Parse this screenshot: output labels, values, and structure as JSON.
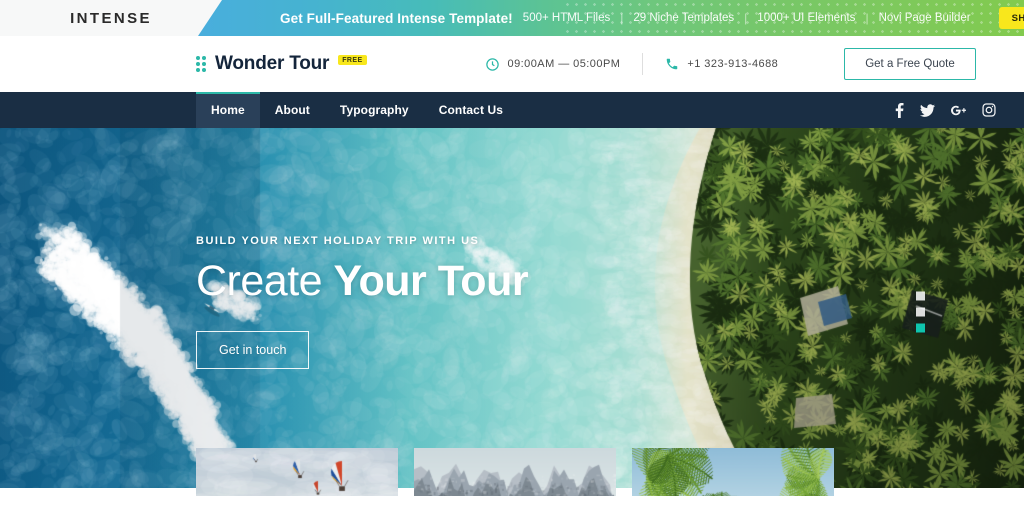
{
  "promo": {
    "logo_text": "INTENSE",
    "headline": "Get Full-Featured Intense Template!",
    "features": [
      "500+ HTML Files",
      "29 Niche Templates",
      "1000+ UI Elements",
      "Novi Page Builder"
    ],
    "separator": "|",
    "cta_label": "SHOP NOW!",
    "gradient_start": "#49aedd",
    "gradient_end": "#82ca4e",
    "cta_color": "#f8e71c"
  },
  "header": {
    "brand_name": "Wonder Tour",
    "brand_badge": "FREE",
    "hours": "09:00AM — 05:00PM",
    "phone": "+1 323-913-4688",
    "quote_label": "Get a Free Quote",
    "accent_color": "#2cb8a8"
  },
  "nav": {
    "items": [
      {
        "label": "Home",
        "active": true
      },
      {
        "label": "About",
        "active": false
      },
      {
        "label": "Typography",
        "active": false
      },
      {
        "label": "Contact Us",
        "active": false
      }
    ],
    "social": [
      "facebook-icon",
      "twitter-icon",
      "google-plus-icon",
      "instagram-icon"
    ],
    "bar_color": "#1a2e44",
    "active_indicator_color": "#2cb8a8"
  },
  "hero": {
    "kicker": "BUILD YOUR NEXT HOLIDAY TRIP WITH US",
    "title_light": "Create",
    "title_bold": "Your Tour",
    "button_label": "Get in touch",
    "slides_total": 3,
    "slide_active": 3,
    "scene": "aerial-tropical-beach-with-palm-forest-and-boats"
  },
  "gallery": {
    "thumbs": [
      {
        "name": "hot-air-balloons"
      },
      {
        "name": "mountain-range"
      },
      {
        "name": "palm-trees"
      }
    ]
  }
}
